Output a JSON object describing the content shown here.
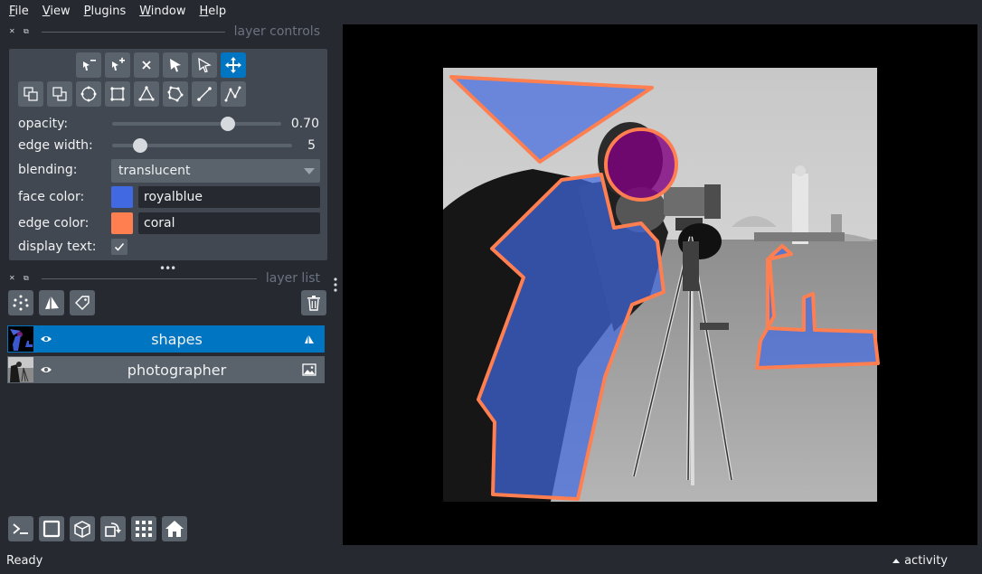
{
  "menu": {
    "file": {
      "u": "F",
      "rest": "ile"
    },
    "view": {
      "u": "V",
      "rest": "iew"
    },
    "plugins": {
      "u": "P",
      "rest": "lugins"
    },
    "window": {
      "u": "W",
      "rest": "indow"
    },
    "help": {
      "u": "H",
      "rest": "elp"
    }
  },
  "layer_controls": {
    "title": "layer controls",
    "opacity": {
      "label": "opacity:",
      "value_text": "0.70",
      "value": 0.7
    },
    "edge_width": {
      "label": "edge width:",
      "value_text": "5",
      "value": 5,
      "max": 40
    },
    "blending": {
      "label": "blending:",
      "value": "translucent"
    },
    "face_color": {
      "label": "face color:",
      "value": "royalblue",
      "hex": "#4169e1"
    },
    "edge_color": {
      "label": "edge color:",
      "value": "coral",
      "hex": "#ff7f50"
    },
    "display_text": {
      "label": "display text:",
      "checked": true
    }
  },
  "layer_list": {
    "title": "layer list",
    "layers": [
      {
        "name": "shapes",
        "selected": true,
        "type_icon": "shapes-layer-icon"
      },
      {
        "name": "photographer",
        "selected": false,
        "type_icon": "image-layer-icon"
      }
    ]
  },
  "status": {
    "text": "Ready",
    "activity": "activity"
  },
  "colors": {
    "accent": "#0076c2",
    "panel": "#414851",
    "background": "#262930"
  }
}
